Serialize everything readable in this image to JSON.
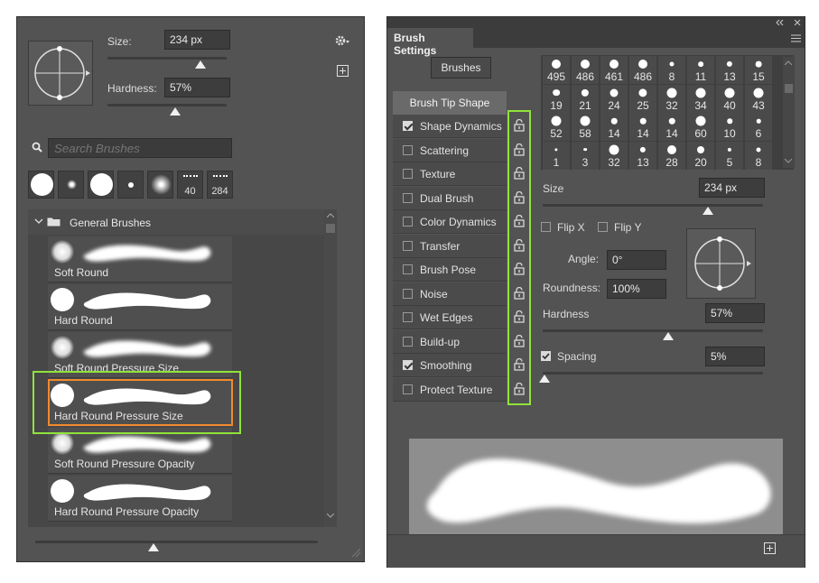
{
  "left_panel": {
    "size_label": "Size:",
    "size_value": "234 px",
    "size_level": 0.78,
    "hardness_label": "Hardness:",
    "hardness_value": "57%",
    "hardness_level": 0.57,
    "search_placeholder": "Search Brushes",
    "recent_presets": [
      {
        "type": "hard",
        "count": ""
      },
      {
        "type": "soft-small",
        "count": ""
      },
      {
        "type": "hard",
        "count": ""
      },
      {
        "type": "soft-tiny",
        "count": ""
      },
      {
        "type": "soft",
        "count": ""
      },
      {
        "type": "spatter",
        "count": "40"
      },
      {
        "type": "spatter",
        "count": "284"
      }
    ],
    "group_name": "General Brushes",
    "brushes": [
      {
        "name": "Soft Round",
        "tip": "soft"
      },
      {
        "name": "Hard Round",
        "tip": "hard"
      },
      {
        "name": "Soft Round Pressure Size",
        "tip": "soft"
      },
      {
        "name": "Hard Round Pressure Size",
        "tip": "hard",
        "selected": true
      },
      {
        "name": "Soft Round Pressure Opacity",
        "tip": "soft"
      },
      {
        "name": "Hard Round Pressure Opacity",
        "tip": "hard"
      }
    ],
    "preview_level": 0.42
  },
  "right_panel": {
    "tab_title": "Brush Settings",
    "brushes_button": "Brushes",
    "tip_shape_label": "Brush Tip Shape",
    "options": [
      {
        "label": "Shape Dynamics",
        "checked": true
      },
      {
        "label": "Scattering",
        "checked": false
      },
      {
        "label": "Texture",
        "checked": false
      },
      {
        "label": "Dual Brush",
        "checked": false
      },
      {
        "label": "Color Dynamics",
        "checked": false
      },
      {
        "label": "Transfer",
        "checked": false
      },
      {
        "label": "Brush Pose",
        "checked": false
      },
      {
        "label": "Noise",
        "checked": false
      },
      {
        "label": "Wet Edges",
        "checked": false
      },
      {
        "label": "Build-up",
        "checked": false
      },
      {
        "label": "Smoothing",
        "checked": true
      },
      {
        "label": "Protect Texture",
        "checked": false
      }
    ],
    "tip_sizes": [
      "495",
      "486",
      "461",
      "486",
      "8",
      "11",
      "13",
      "15",
      "19",
      "21",
      "24",
      "25",
      "32",
      "34",
      "40",
      "43",
      "52",
      "58",
      "14",
      "14",
      "14",
      "60",
      "10",
      "6",
      "1",
      "3",
      "32",
      "13",
      "28",
      "20",
      "5",
      "8"
    ],
    "size_label": "Size",
    "size_value": "234 px",
    "size_level": 0.75,
    "flip_x_label": "Flip X",
    "flip_y_label": "Flip Y",
    "angle_label": "Angle:",
    "angle_value": "0°",
    "roundness_label": "Roundness:",
    "roundness_value": "100%",
    "hardness_label": "Hardness",
    "hardness_value": "57%",
    "hardness_level": 0.57,
    "spacing_label": "Spacing",
    "spacing_checked": true,
    "spacing_value": "5%",
    "spacing_level": 0.01
  },
  "highlight_colors": {
    "green": "#8fe33a",
    "orange": "#f28a2e"
  }
}
